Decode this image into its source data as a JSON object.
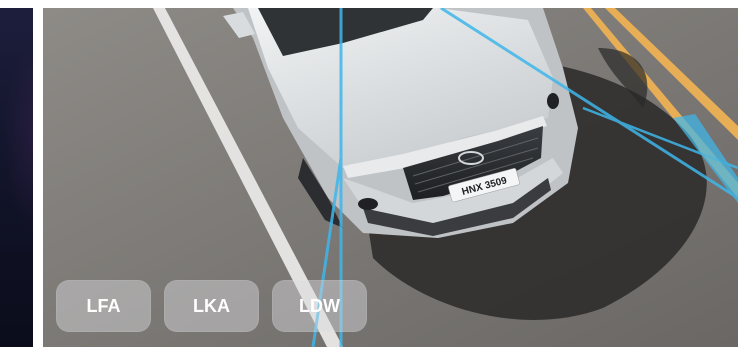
{
  "features": [
    {
      "label": "LFA"
    },
    {
      "label": "LKA"
    },
    {
      "label": "LDW"
    }
  ],
  "plate": {
    "text": "HNX 3509"
  },
  "colors": {
    "sensor_beam": "#3fb6ea",
    "lane_yellow": "#e8b25a",
    "road": "#7d7a76",
    "car_body": "#dfe2e4",
    "chip_text": "#ffffff"
  }
}
